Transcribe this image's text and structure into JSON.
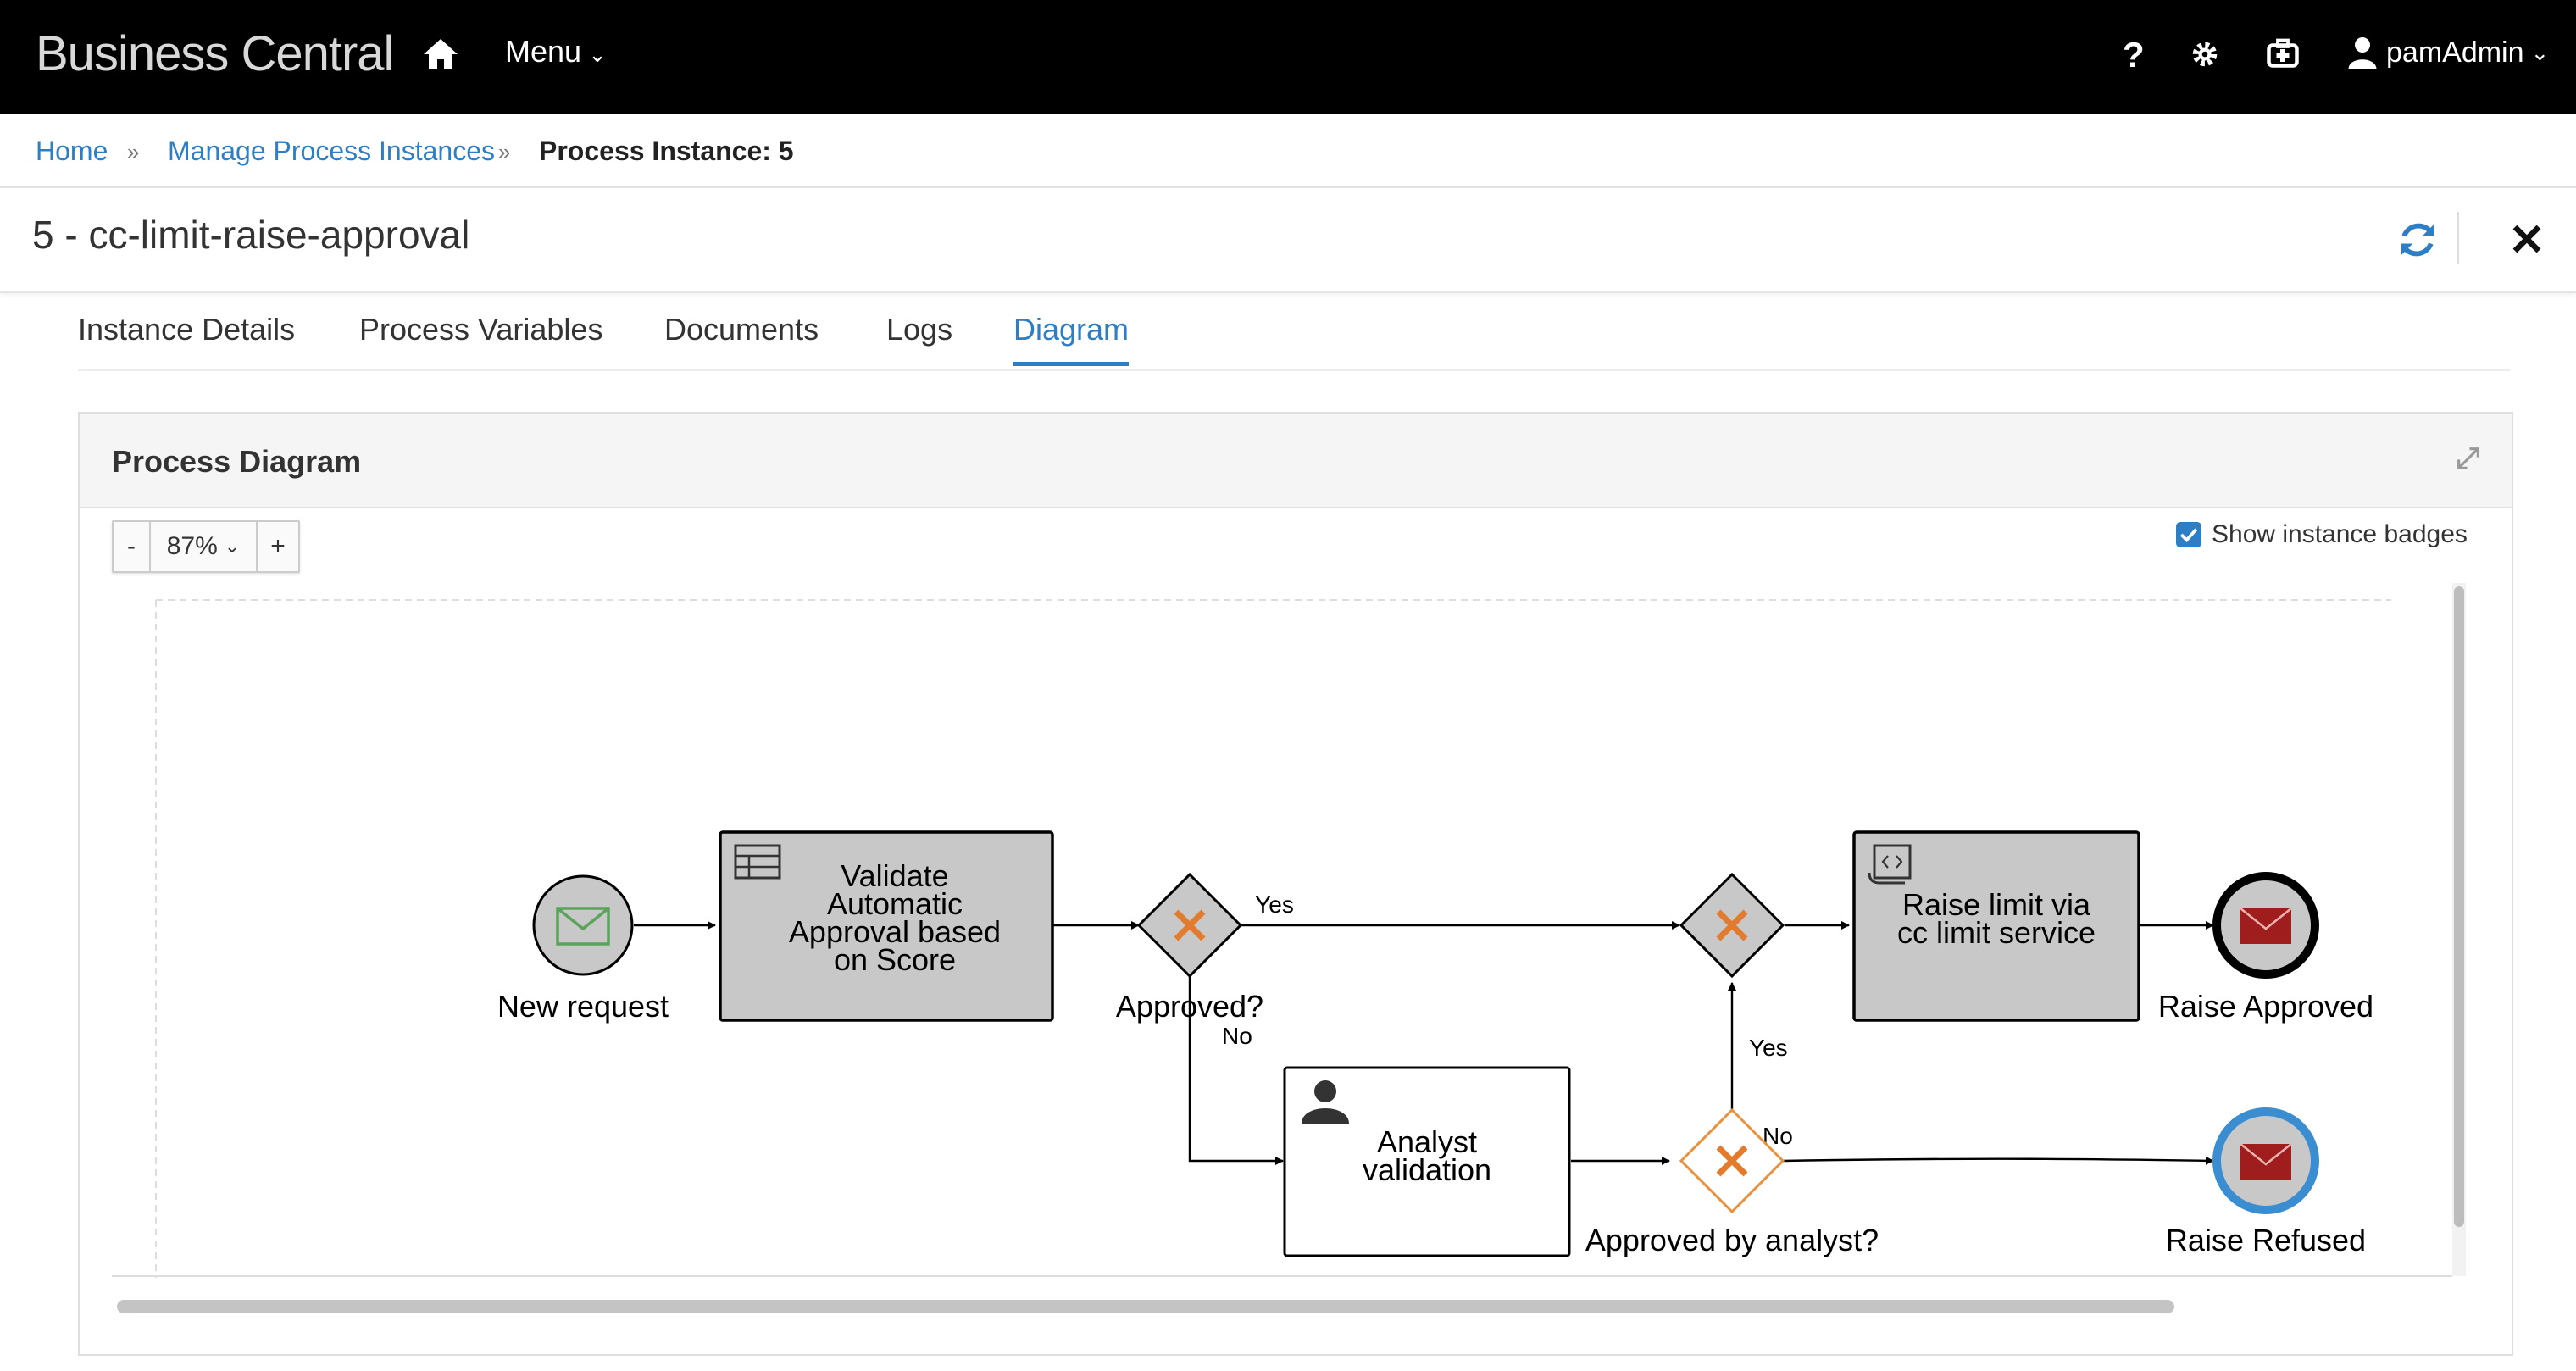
{
  "app": {
    "brand": "Business Central",
    "menu_label": "Menu",
    "user_name": "pamAdmin"
  },
  "icons": {
    "home": "home-icon",
    "help": "question-icon",
    "settings": "gear-icon",
    "tasks": "briefcase-icon",
    "user": "user-icon"
  },
  "breadcrumb": {
    "home": "Home",
    "manage": "Manage Process Instances",
    "current": "Process Instance: 5",
    "separator": "»"
  },
  "page": {
    "title": "5 - cc-limit-raise-approval"
  },
  "tabs": [
    {
      "label": "Instance Details"
    },
    {
      "label": "Process Variables"
    },
    {
      "label": "Documents"
    },
    {
      "label": "Logs"
    },
    {
      "label": "Diagram",
      "active": true
    }
  ],
  "panel": {
    "title": "Process Diagram",
    "show_badges_label": "Show instance badges",
    "show_badges_checked": true
  },
  "zoom": {
    "minus": "-",
    "value": "87%",
    "plus": "+"
  },
  "diagram": {
    "nodes": {
      "start": "New request",
      "task1_line1": "Validate",
      "task1_line2": "Automatic",
      "task1_line3": "Approval based",
      "task1_line4": "on Score",
      "gw1": "Approved?",
      "task2_line1": "Analyst",
      "task2_line2": "validation",
      "gw2": "Approved by analyst?",
      "task3_line1": "Raise limit via",
      "task3_line2": "cc limit service",
      "end_ok": "Raise Approved",
      "end_refused": "Raise Refused"
    },
    "edges": {
      "yes1": "Yes",
      "no1": "No",
      "yes2": "Yes",
      "no2": "No"
    }
  },
  "colors": {
    "accent": "#2d7ec4",
    "gateway_x": "#e27b2e",
    "end_fill": "#a01d1d",
    "task_grey": "#c8c8c8",
    "start_icon": "#5aa35a"
  }
}
